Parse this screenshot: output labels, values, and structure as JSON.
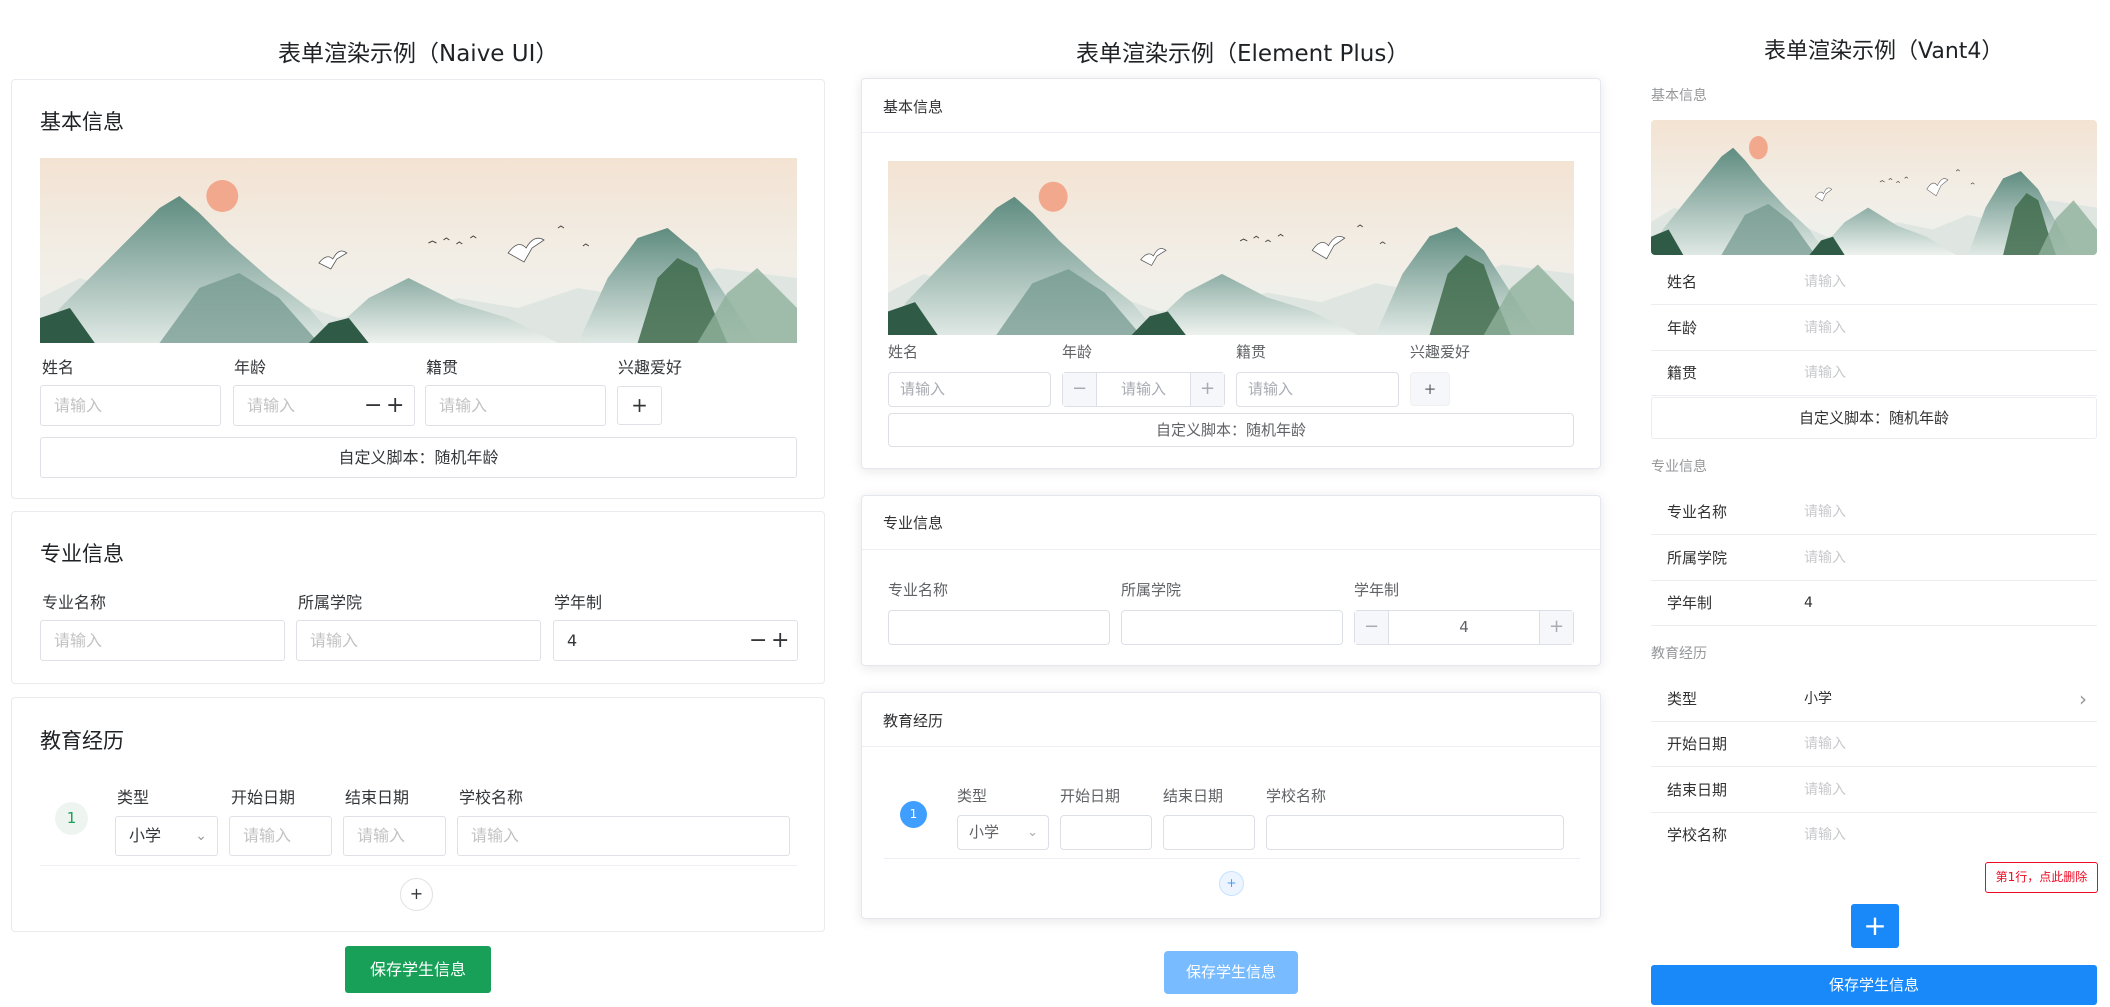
{
  "colors": {
    "naive_primary": "#18a058",
    "element_primary": "#409eff",
    "element_save": "#79bbff",
    "vant_primary": "#1989fa",
    "vant_danger": "#ee0a24"
  },
  "naive": {
    "title": "表单渲染示例（Naive UI）",
    "basic": {
      "title": "基本信息",
      "image_name": "landscape-banner",
      "labels": {
        "name": "姓名",
        "age": "年龄",
        "hometown": "籍贯",
        "hobby": "兴趣爱好"
      },
      "placeholders": {
        "name": "请输入",
        "age": "请输入",
        "hometown": "请输入"
      },
      "stepper_minus": "−",
      "stepper_plus": "+",
      "hobby_add": "+",
      "script_button": "自定义脚本：随机年龄"
    },
    "major": {
      "title": "专业信息",
      "labels": {
        "major": "专业名称",
        "college": "所属学院",
        "years": "学年制"
      },
      "placeholders": {
        "major": "请输入",
        "college": "请输入"
      },
      "years_value": "4",
      "stepper_minus": "−",
      "stepper_plus": "+"
    },
    "edu": {
      "title": "教育经历",
      "row_index": "1",
      "labels": {
        "type": "类型",
        "start": "开始日期",
        "end": "结束日期",
        "school": "学校名称"
      },
      "type_value": "小学",
      "placeholders": {
        "start": "请输入",
        "end": "请输入",
        "school": "请输入"
      },
      "add_row": "+"
    },
    "save_button": "保存学生信息"
  },
  "element": {
    "title": "表单渲染示例（Element Plus）",
    "basic": {
      "title": "基本信息",
      "labels": {
        "name": "姓名",
        "age": "年龄",
        "hometown": "籍贯",
        "hobby": "兴趣爱好"
      },
      "placeholders": {
        "name": "请输入",
        "age": "请输入",
        "hometown": "请输入"
      },
      "stepper_minus": "−",
      "stepper_plus": "+",
      "hobby_add": "+",
      "script_button": "自定义脚本：随机年龄"
    },
    "major": {
      "title": "专业信息",
      "labels": {
        "major": "专业名称",
        "college": "所属学院",
        "years": "学年制"
      },
      "years_value": "4",
      "stepper_minus": "−",
      "stepper_plus": "+"
    },
    "edu": {
      "title": "教育经历",
      "row_index": "1",
      "labels": {
        "type": "类型",
        "start": "开始日期",
        "end": "结束日期",
        "school": "学校名称"
      },
      "type_value": "小学",
      "add_row": "+"
    },
    "save_button": "保存学生信息"
  },
  "vant": {
    "title": "表单渲染示例（Vant4）",
    "basic": {
      "title": "基本信息",
      "cells": [
        {
          "label": "姓名",
          "value": "请输入"
        },
        {
          "label": "年龄",
          "value": "请输入"
        },
        {
          "label": "籍贯",
          "value": "请输入"
        }
      ],
      "script_button": "自定义脚本：随机年龄"
    },
    "major": {
      "title": "专业信息",
      "cells": [
        {
          "label": "专业名称",
          "value": "请输入"
        },
        {
          "label": "所属学院",
          "value": "请输入"
        },
        {
          "label": "学年制",
          "value": "4"
        }
      ]
    },
    "edu": {
      "title": "教育经历",
      "cells": [
        {
          "label": "类型",
          "value": "小学"
        },
        {
          "label": "开始日期",
          "value": "请输入"
        },
        {
          "label": "结束日期",
          "value": "请输入"
        },
        {
          "label": "学校名称",
          "value": "请输入"
        }
      ],
      "delete_button": "第1行，点此删除",
      "add_button": "+"
    },
    "save_button": "保存学生信息"
  }
}
